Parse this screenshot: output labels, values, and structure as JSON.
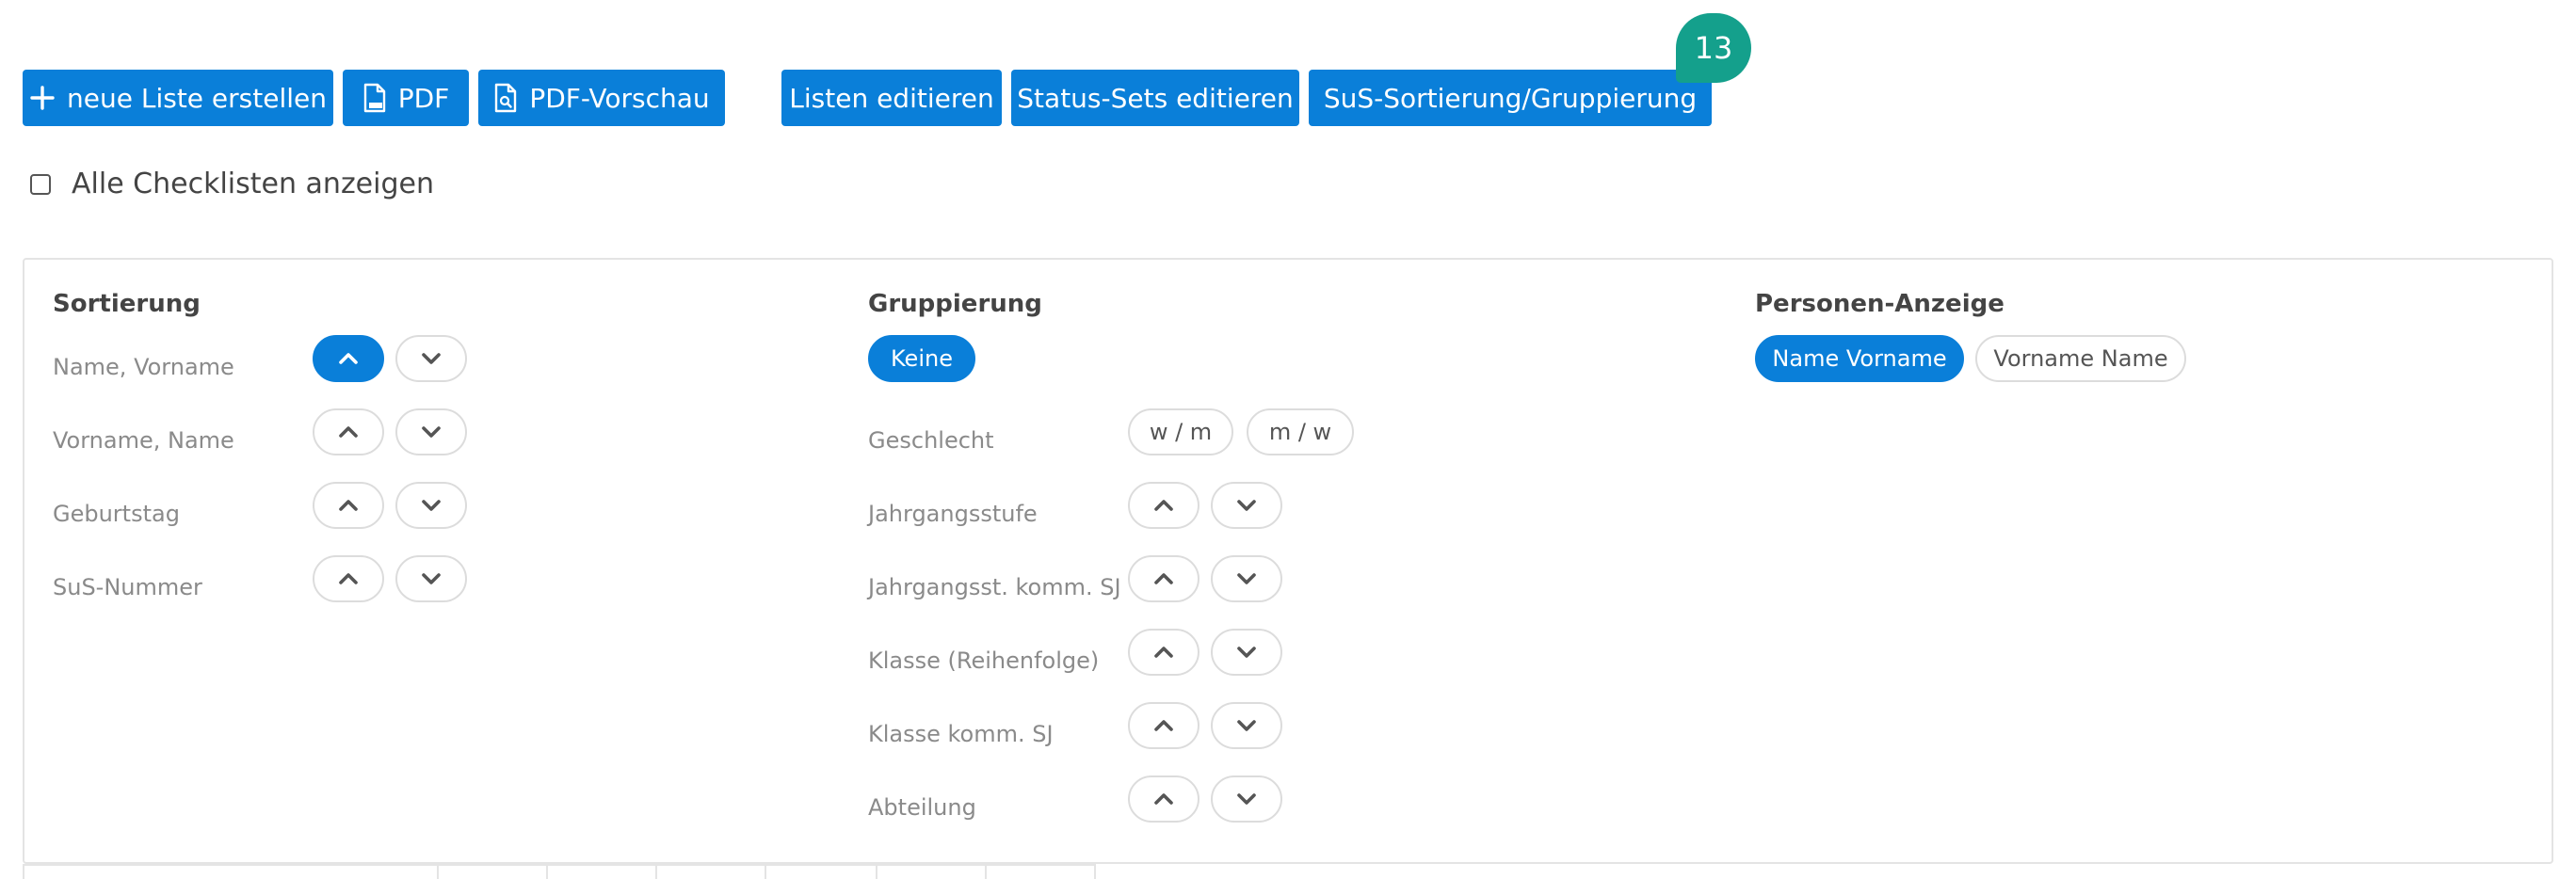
{
  "toolbar": {
    "new_list_label": "neue Liste erstellen",
    "pdf_label": "PDF",
    "pdf_preview_label": "PDF-Vorschau",
    "edit_lists_label": "Listen editieren",
    "edit_status_sets_label": "Status-Sets editieren",
    "sorting_grouping_label": "SuS-Sortierung/Gruppierung",
    "badge_count": "13"
  },
  "show_all": {
    "label": "Alle Checklisten anzeigen",
    "checked": false
  },
  "sorting": {
    "title": "Sortierung",
    "rows": [
      {
        "label": "Name, Vorname",
        "active": "up"
      },
      {
        "label": "Vorname, Name"
      },
      {
        "label": "Geburtstag"
      },
      {
        "label": "SuS-Nummer"
      }
    ]
  },
  "grouping": {
    "title": "Gruppierung",
    "none_label": "Keine",
    "gender_label": "Geschlecht",
    "gender_options": [
      "w / m",
      "m / w"
    ],
    "rows": [
      {
        "label": "Jahrgangsstufe"
      },
      {
        "label": "Jahrgangsst. komm. SJ"
      },
      {
        "label": "Klasse (Reihenfolge)"
      },
      {
        "label": "Klasse komm. SJ"
      },
      {
        "label": "Abteilung"
      }
    ]
  },
  "person_display": {
    "title": "Personen-Anzeige",
    "options": [
      "Name Vorname",
      "Vorname Name"
    ],
    "selected": "Name Vorname"
  },
  "colors": {
    "accent": "#0a7fd9",
    "badge": "#14a08c"
  },
  "icons": {
    "up": "chevron-up-icon",
    "down": "chevron-down-icon"
  }
}
